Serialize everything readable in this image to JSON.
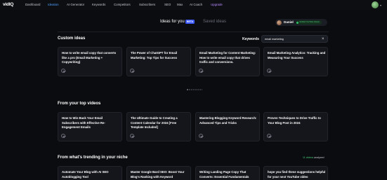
{
  "brand": {
    "logo_main": "vid",
    "logo_iq": "IQ"
  },
  "nav": {
    "items": [
      {
        "label": "Dashboard"
      },
      {
        "label": "Ideation",
        "active": true
      },
      {
        "label": "AI Generator"
      },
      {
        "label": "Keywords"
      },
      {
        "label": "Competitors"
      },
      {
        "label": "Subscribers"
      },
      {
        "label": "SEO"
      },
      {
        "label": "Max"
      },
      {
        "label": "AI Coach"
      },
      {
        "label": "Upgrade"
      }
    ]
  },
  "tabs": {
    "ideas_for_you": "Ideas for you",
    "beta": "BETA",
    "saved_ideas": "Saved ideas"
  },
  "user_chip": {
    "name": "Daniel",
    "verified": "Verified YouTube Owner"
  },
  "custom_ideas": {
    "title": "Custom ideas",
    "keywords_label": "Keywords",
    "keyword_value": "email marketing",
    "cards": [
      {
        "title": "How to write email copy that converts like a pro (Email Marketing + Copywriting)"
      },
      {
        "title": "The Power of ChatGPT for Email Marketing: Top Tips for Success"
      },
      {
        "title": "Email Marketing for Content Marketing: How to write email copy that drives traffic and conversions."
      },
      {
        "title": "Email Marketing Analytics: Tracking and Measuring Your Success"
      }
    ]
  },
  "top_videos": {
    "title": "From your top videos",
    "cards": [
      {
        "title": "How to Win Back Your Email Subscribers with Effective Re-Engagement Emails"
      },
      {
        "title": "The Ultimate Guide to Creating a Content Calendar for 2024 [Free Template Included]"
      },
      {
        "title": "Mastering Blogging Keyword Research: Advanced Tips and Tricks"
      },
      {
        "title": "Proven Techniques to Drive Traffic to Your Blog Post in 2024"
      }
    ]
  },
  "trending": {
    "title": "From what's trending in your niche",
    "videos_count": "11 videos",
    "videos_suffix": " analyzed",
    "cards": [
      {
        "title": "Automate Your Blog with AI SEO Autoblogging Tool"
      },
      {
        "title": "Master Google Bard SEO: Boost Your Blog's Ranking with Keyword"
      },
      {
        "title": "Writing Landing Page Copy That Converts: Essential Fundamentals"
      },
      {
        "title": "hope you find these suggestions helpful for your next YouTube video"
      }
    ]
  },
  "colors": {
    "accent": "#4ea0ff",
    "upgrade": "#b98cff",
    "beta": "#3d5afe",
    "verified": "#2fbf65",
    "background": "#0b0c10",
    "card": "#15161c"
  },
  "icons": {
    "card_action": "chevron-circle-icon",
    "clear": "close-icon"
  }
}
